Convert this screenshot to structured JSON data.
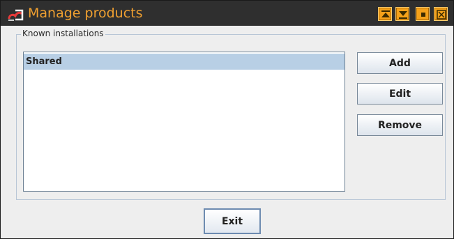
{
  "window": {
    "title": "Manage products",
    "controls": [
      {
        "name": "minimize-to-top",
        "icon": "arrow-up-to-bar-icon"
      },
      {
        "name": "minimize-to-bottom",
        "icon": "arrow-down-to-bar-icon"
      },
      {
        "name": "maximize",
        "icon": "square-icon"
      },
      {
        "name": "close",
        "icon": "close-x-icon"
      }
    ],
    "title_color": "#f0a030",
    "button_color": "#f4a11a"
  },
  "installations": {
    "legend": "Known installations",
    "items": [
      {
        "label": "Shared",
        "selected": true
      }
    ],
    "selection_color": "#b8cfe5"
  },
  "actions": {
    "add_label": "Add",
    "edit_label": "Edit",
    "remove_label": "Remove"
  },
  "footer": {
    "exit_label": "Exit"
  }
}
